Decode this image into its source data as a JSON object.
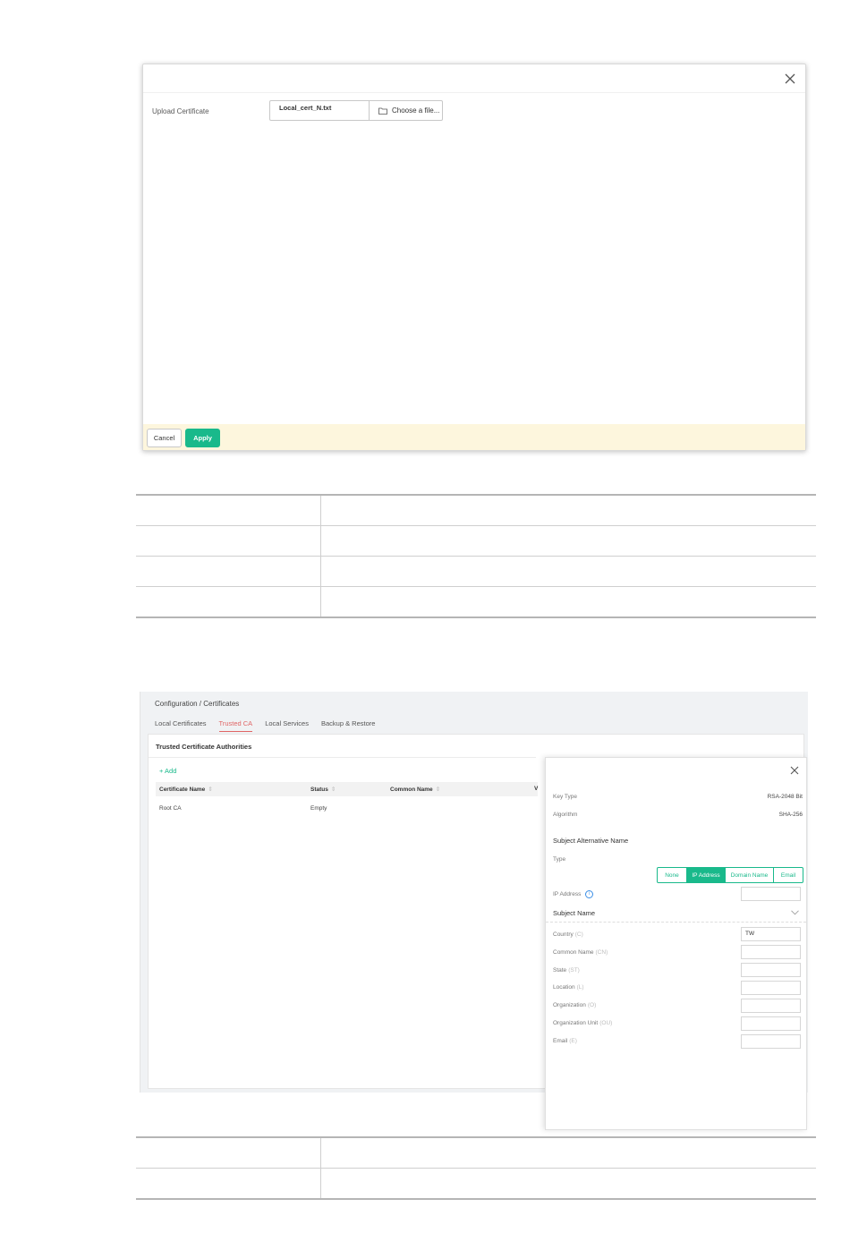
{
  "upload_dialog": {
    "field_label": "Upload Certificate",
    "file_name": "Local_cert_N.txt",
    "choose_label": "Choose a file...",
    "cancel_label": "Cancel",
    "apply_label": "Apply"
  },
  "certificates_screen": {
    "breadcrumb": "Configuration / Certificates",
    "tabs": [
      {
        "label": "Local Certificates",
        "active": false
      },
      {
        "label": "Trusted CA",
        "active": true
      },
      {
        "label": "Local Services",
        "active": false
      },
      {
        "label": "Backup & Restore",
        "active": false
      }
    ],
    "panel_title": "Trusted Certificate Authorities",
    "add_label": "+ Add",
    "columns": [
      "Certificate Name",
      "Status",
      "Common Name",
      "V"
    ],
    "rows": [
      {
        "name": "Root CA",
        "status": "Empty",
        "common_name": ""
      }
    ],
    "drawer": {
      "key_type_label": "Key Type",
      "key_type_value": "RSA-2048 Bit",
      "algorithm_label": "Algorithm",
      "algorithm_value": "SHA-256",
      "san_heading": "Subject Alternative Name",
      "type_label": "Type",
      "type_options": [
        "None",
        "IP Address",
        "Domain Name",
        "Email"
      ],
      "type_selected": "IP Address",
      "ip_label": "IP Address",
      "ip_value": "",
      "subject_heading": "Subject Name",
      "fields": [
        {
          "label": "Country",
          "abbr": "(C)",
          "value": "TW"
        },
        {
          "label": "Common Name",
          "abbr": "(CN)",
          "value": ""
        },
        {
          "label": "State",
          "abbr": "(ST)",
          "value": ""
        },
        {
          "label": "Location",
          "abbr": "(L)",
          "value": ""
        },
        {
          "label": "Organization",
          "abbr": "(O)",
          "value": ""
        },
        {
          "label": "Organization Unit",
          "abbr": "(OU)",
          "value": ""
        },
        {
          "label": "Email",
          "abbr": "(E)",
          "value": ""
        }
      ]
    }
  },
  "colors": {
    "accent": "#19b98b",
    "active_tab": "#e06666",
    "footer_bg": "#fdf6dd"
  }
}
